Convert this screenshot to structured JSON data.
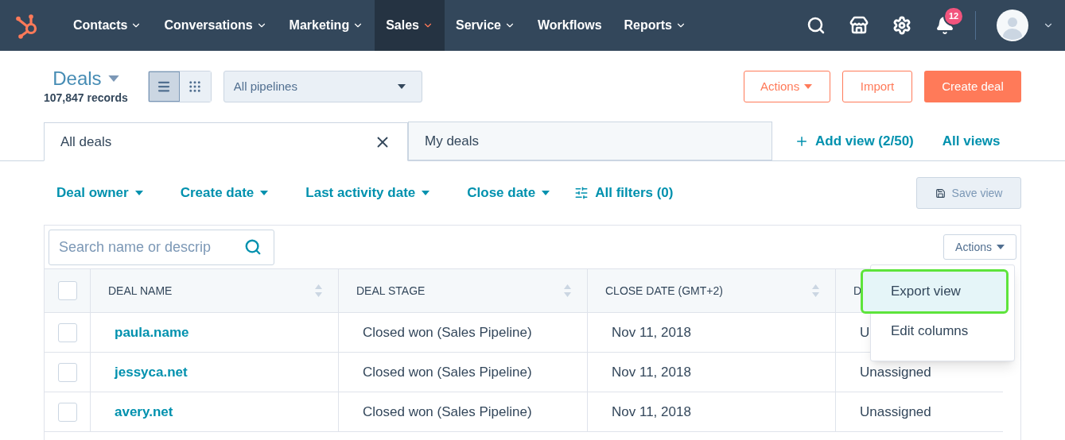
{
  "nav": {
    "items": [
      {
        "label": "Contacts",
        "dropdown": true,
        "selected": false
      },
      {
        "label": "Conversations",
        "dropdown": true,
        "selected": false
      },
      {
        "label": "Marketing",
        "dropdown": true,
        "selected": false
      },
      {
        "label": "Sales",
        "dropdown": true,
        "selected": true
      },
      {
        "label": "Service",
        "dropdown": true,
        "selected": false
      },
      {
        "label": "Workflows",
        "dropdown": false,
        "selected": false
      },
      {
        "label": "Reports",
        "dropdown": true,
        "selected": false
      }
    ],
    "notification_count": "12"
  },
  "header": {
    "title": "Deals",
    "record_count": "107,847 records",
    "view_buttons": [
      {
        "kind": "list",
        "selected": true
      },
      {
        "kind": "board",
        "selected": false
      }
    ],
    "pipeline": "All pipelines",
    "buttons": [
      {
        "label": "Actions",
        "kind": "outline",
        "caret": true
      },
      {
        "label": "Import",
        "kind": "outline",
        "caret": false
      },
      {
        "label": "Create deal",
        "kind": "primary",
        "caret": false
      }
    ]
  },
  "views": {
    "tabs": [
      {
        "label": "All deals",
        "selected": true,
        "closable": true
      },
      {
        "label": "My deals",
        "selected": false,
        "closable": false
      }
    ],
    "add_view": "Add view (2/50)",
    "all_views": "All views"
  },
  "filters": {
    "items": [
      "Deal owner",
      "Create date",
      "Last activity date",
      "Close date"
    ],
    "all_filters": "All filters (0)",
    "save_view": "Save view"
  },
  "table": {
    "search": {
      "placeholder": "Search name or descrip"
    },
    "actions": "Actions",
    "all_checked": false,
    "columns": [
      "DEAL NAME",
      "DEAL STAGE",
      "CLOSE DATE (GMT+2)",
      "D"
    ],
    "rows": [
      {
        "checked": false,
        "cells": [
          "paula.name",
          "Closed won (Sales Pipeline)",
          "Nov 11, 2018",
          "U"
        ]
      },
      {
        "checked": false,
        "cells": [
          "jessyca.net",
          "Closed won (Sales Pipeline)",
          "Nov 11, 2018",
          "Unassigned"
        ]
      },
      {
        "checked": false,
        "cells": [
          "avery.net",
          "Closed won (Sales Pipeline)",
          "Nov 11, 2018",
          "Unassigned"
        ]
      }
    ],
    "menu": [
      {
        "label": "Export view",
        "highlighted": true
      },
      {
        "label": "Edit columns",
        "highlighted": false
      }
    ]
  }
}
